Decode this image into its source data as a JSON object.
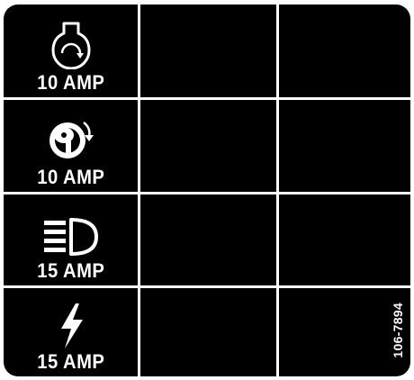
{
  "fuse_panel": {
    "rows": [
      {
        "icon": "engine-crank-icon",
        "rating": "10 AMP"
      },
      {
        "icon": "ignition-key-icon",
        "rating": "10 AMP"
      },
      {
        "icon": "headlight-icon",
        "rating": "15 AMP"
      },
      {
        "icon": "power-lightning-icon",
        "rating": "15 AMP"
      }
    ],
    "part_number": "106-7894"
  },
  "colors": {
    "background": "#000000",
    "foreground": "#ffffff"
  }
}
